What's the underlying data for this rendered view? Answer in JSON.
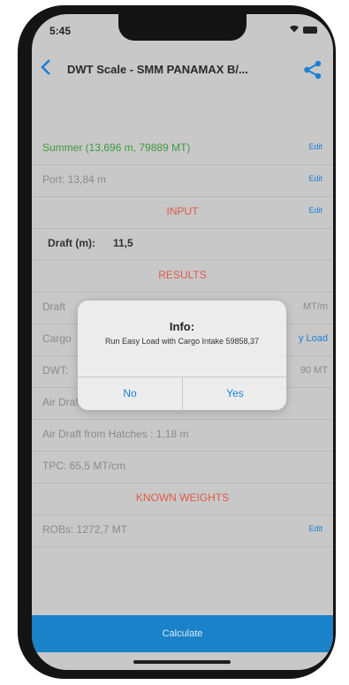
{
  "status_bar": {
    "time": "5:45"
  },
  "nav": {
    "title": "DWT Scale - SMM PANAMAX B/..."
  },
  "rows": {
    "summer": {
      "label": "Summer (13,696 m, 79889 MT)",
      "edit": "Edit"
    },
    "port": {
      "label": "Port: 13,84 m",
      "edit": "Edit"
    },
    "input": {
      "label": "INPUT",
      "edit": "Edit"
    },
    "draft": {
      "label": "Draft (m):",
      "value": "11,5"
    },
    "results": {
      "label": "RESULTS"
    },
    "draft_result": {
      "label": "Draft",
      "suffix": "MT/m"
    },
    "cargo": {
      "label": "Cargo",
      "suffix": "y Load"
    },
    "dwt": {
      "label": "DWT:",
      "suffix": "90 MT"
    },
    "air_mast": {
      "label": "Air Draft from Radar Mast: 35,68 m"
    },
    "air_hatch": {
      "label": "Air Draft from Hatches : 1,18 m"
    },
    "tpc": {
      "label": "TPC: 65,5 MT/cm"
    },
    "known": {
      "label": "KNOWN WEIGHTS"
    },
    "rob": {
      "label": "ROBs: 1272,7 MT",
      "edit": "Edit"
    }
  },
  "calculate_label": "Calculate",
  "dialog": {
    "title": "Info:",
    "message": "Run Easy Load with Cargo Intake 59858,37",
    "no_label": "No",
    "yes_label": "Yes"
  },
  "colors": {
    "accent": "#1a7fd6",
    "section": "#e0584a",
    "summer": "#3d9a3d",
    "calc_bar": "#1a82c9"
  },
  "icons": {
    "back": "chevron-left-icon",
    "share": "share-icon"
  }
}
